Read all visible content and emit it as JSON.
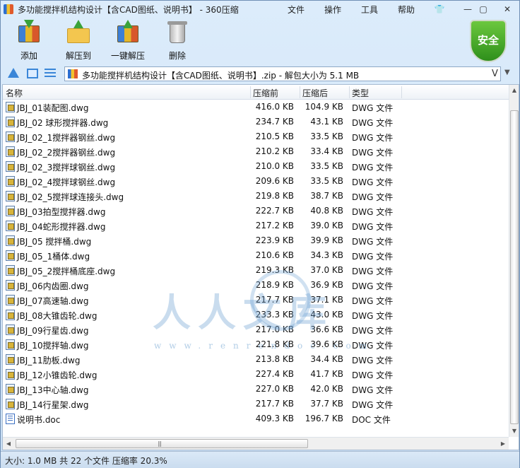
{
  "window": {
    "title": "多功能搅拌机结构设计【含CAD图纸、说明书】 - 360压缩",
    "menus": [
      "文件",
      "操作",
      "工具",
      "帮助"
    ]
  },
  "toolbar": {
    "add_label": "添加",
    "extract_label": "解压到",
    "one_click_label": "一键解压",
    "delete_label": "删除",
    "security_label": "安全"
  },
  "address": {
    "path": "多功能搅拌机结构设计【含CAD图纸、说明书】.zip - 解包大小为 5.1 MB",
    "v": "V"
  },
  "columns": {
    "name": "名称",
    "size": "压缩前",
    "compressed": "压缩后",
    "type": "类型"
  },
  "files": [
    {
      "name": "JBJ_01装配图.dwg",
      "size": "416.0 KB",
      "compressed": "104.9 KB",
      "type": "DWG 文件",
      "icon": "dwg-file-icon"
    },
    {
      "name": "JBJ_02 球形搅拌器.dwg",
      "size": "234.7 KB",
      "compressed": "43.1 KB",
      "type": "DWG 文件",
      "icon": "dwg-file-icon"
    },
    {
      "name": "JBJ_02_1搅拌器钢丝.dwg",
      "size": "210.5 KB",
      "compressed": "33.5 KB",
      "type": "DWG 文件",
      "icon": "dwg-file-icon"
    },
    {
      "name": "JBJ_02_2搅拌器钢丝.dwg",
      "size": "210.2 KB",
      "compressed": "33.4 KB",
      "type": "DWG 文件",
      "icon": "dwg-file-icon"
    },
    {
      "name": "JBJ_02_3搅拌球钢丝.dwg",
      "size": "210.0 KB",
      "compressed": "33.5 KB",
      "type": "DWG 文件",
      "icon": "dwg-file-icon"
    },
    {
      "name": "JBJ_02_4搅拌球钢丝.dwg",
      "size": "209.6 KB",
      "compressed": "33.5 KB",
      "type": "DWG 文件",
      "icon": "dwg-file-icon"
    },
    {
      "name": "JBJ_02_5搅拌球连接头.dwg",
      "size": "219.8 KB",
      "compressed": "38.7 KB",
      "type": "DWG 文件",
      "icon": "dwg-file-icon"
    },
    {
      "name": "JBJ_03拍型搅拌器.dwg",
      "size": "222.7 KB",
      "compressed": "40.8 KB",
      "type": "DWG 文件",
      "icon": "dwg-file-icon"
    },
    {
      "name": "JBJ_04蛇形搅拌器.dwg",
      "size": "217.2 KB",
      "compressed": "39.0 KB",
      "type": "DWG 文件",
      "icon": "dwg-file-icon"
    },
    {
      "name": "JBJ_05 搅拌桶.dwg",
      "size": "223.9 KB",
      "compressed": "39.9 KB",
      "type": "DWG 文件",
      "icon": "dwg-file-icon"
    },
    {
      "name": "JBJ_05_1桶体.dwg",
      "size": "210.6 KB",
      "compressed": "34.3 KB",
      "type": "DWG 文件",
      "icon": "dwg-file-icon"
    },
    {
      "name": "JBJ_05_2搅拌桶底座.dwg",
      "size": "219.3 KB",
      "compressed": "37.0 KB",
      "type": "DWG 文件",
      "icon": "dwg-file-icon"
    },
    {
      "name": "JBJ_06内齿圈.dwg",
      "size": "218.9 KB",
      "compressed": "36.9 KB",
      "type": "DWG 文件",
      "icon": "dwg-file-icon"
    },
    {
      "name": "JBJ_07高速轴.dwg",
      "size": "217.7 KB",
      "compressed": "37.1 KB",
      "type": "DWG 文件",
      "icon": "dwg-file-icon"
    },
    {
      "name": "JBJ_08大锥齿轮.dwg",
      "size": "233.3 KB",
      "compressed": "43.0 KB",
      "type": "DWG 文件",
      "icon": "dwg-file-icon"
    },
    {
      "name": "JBJ_09行星齿.dwg",
      "size": "217.0 KB",
      "compressed": "36.6 KB",
      "type": "DWG 文件",
      "icon": "dwg-file-icon"
    },
    {
      "name": "JBJ_10搅拌轴.dwg",
      "size": "221.8 KB",
      "compressed": "39.6 KB",
      "type": "DWG 文件",
      "icon": "dwg-file-icon"
    },
    {
      "name": "JBJ_11肋板.dwg",
      "size": "213.8 KB",
      "compressed": "34.4 KB",
      "type": "DWG 文件",
      "icon": "dwg-file-icon"
    },
    {
      "name": "JBJ_12小锥齿轮.dwg",
      "size": "227.4 KB",
      "compressed": "41.7 KB",
      "type": "DWG 文件",
      "icon": "dwg-file-icon"
    },
    {
      "name": "JBJ_13中心轴.dwg",
      "size": "227.0 KB",
      "compressed": "42.0 KB",
      "type": "DWG 文件",
      "icon": "dwg-file-icon"
    },
    {
      "name": "JBJ_14行星架.dwg",
      "size": "217.7 KB",
      "compressed": "37.7 KB",
      "type": "DWG 文件",
      "icon": "dwg-file-icon"
    },
    {
      "name": "说明书.doc",
      "size": "409.3 KB",
      "compressed": "196.7 KB",
      "type": "DOC 文件",
      "icon": "doc-file-icon"
    }
  ],
  "watermark": {
    "text": "人人文库",
    "url": "www.renrendoc.com"
  },
  "status": {
    "text": "大小: 1.0 MB 共 22 个文件 压缩率 20.3%"
  }
}
